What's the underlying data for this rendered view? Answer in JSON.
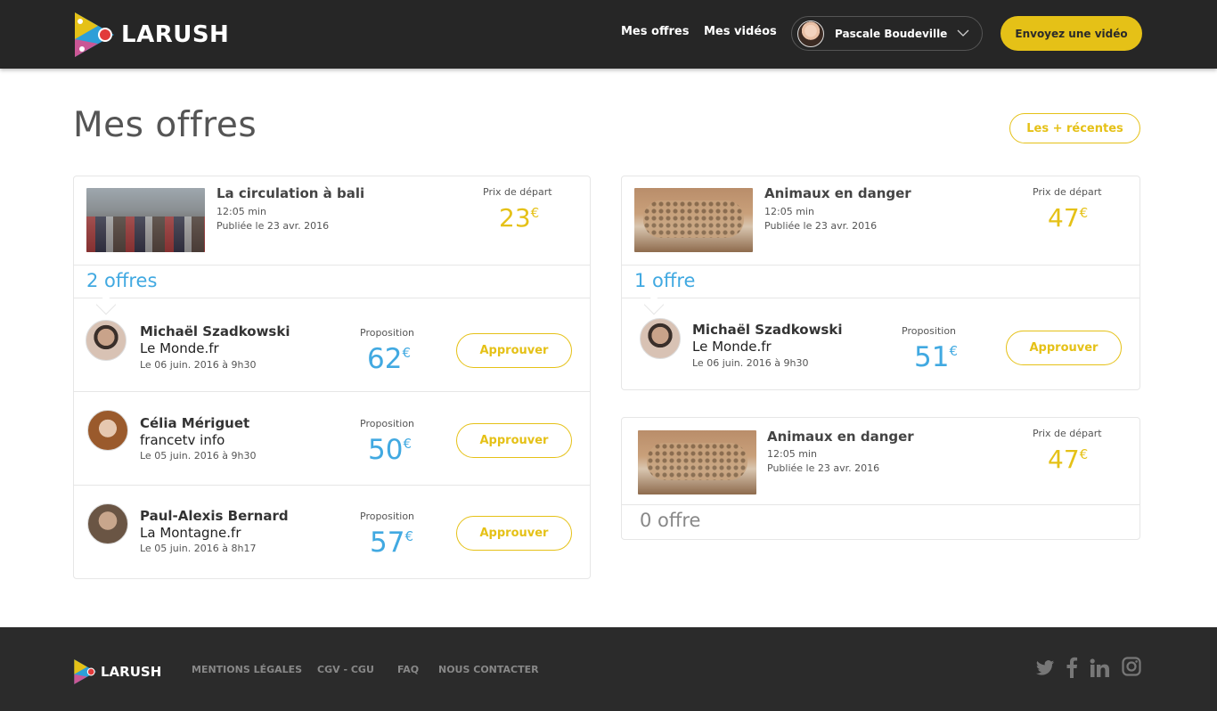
{
  "header": {
    "brand": "LARUSH",
    "nav": {
      "offers": "Mes offres",
      "videos": "Mes vidéos"
    },
    "user": {
      "name": "Pascale Boudeville"
    },
    "send_video": "Envoyez une vidéo"
  },
  "page": {
    "title": "Mes offres",
    "sort_button": "Les + récentes"
  },
  "videos": [
    {
      "title": "La circulation à bali",
      "duration": "12:05 min",
      "published": "Publiée le 23 avr. 2016",
      "price_label": "Prix de départ",
      "price": "23",
      "currency": "€",
      "offers_count": "2 offres",
      "offers": [
        {
          "name": "Michaël Szadkowski",
          "org": "Le Monde.fr",
          "date": "Le 06 juin. 2016 à 9h30",
          "prop_label": "Proposition",
          "amount": "62",
          "currency": "€",
          "action": "Approuver"
        },
        {
          "name": "Célia Mériguet",
          "org": "francetv info",
          "date": "Le 05 juin. 2016 à 9h30",
          "prop_label": "Proposition",
          "amount": "50",
          "currency": "€",
          "action": "Approuver"
        },
        {
          "name": "Paul-Alexis Bernard",
          "org": "La Montagne.fr",
          "date": "Le 05 juin. 2016 à 8h17",
          "prop_label": "Proposition",
          "amount": "57",
          "currency": "€",
          "action": "Approuver"
        }
      ]
    },
    {
      "title": "Animaux en danger",
      "duration": "12:05 min",
      "published": "Publiée le 23 avr. 2016",
      "price_label": "Prix de départ",
      "price": "47",
      "currency": "€",
      "offers_count": "1 offre",
      "offers": [
        {
          "name": "Michaël Szadkowski",
          "org": "Le Monde.fr",
          "date": "Le 06 juin. 2016 à 9h30",
          "prop_label": "Proposition",
          "amount": "51",
          "currency": "€",
          "action": "Approuver"
        }
      ]
    },
    {
      "title": "Animaux en danger",
      "duration": "12:05 min",
      "published": "Publiée le 23 avr. 2016",
      "price_label": "Prix de départ",
      "price": "47",
      "currency": "€",
      "offers_count": "0 offre",
      "offers": []
    }
  ],
  "footer": {
    "brand": "LARUSH",
    "links": [
      "MENTIONS LÉGALES",
      "CGV - CGU",
      "FAQ",
      "NOUS CONTACTER"
    ],
    "social": [
      "twitter-icon",
      "facebook-icon",
      "linkedin-icon",
      "instagram-icon"
    ]
  },
  "colors": {
    "accent": "#e5c117",
    "blue": "#41a9e1",
    "header_bg": "#262626",
    "footer_bg": "#2b2b2b"
  }
}
